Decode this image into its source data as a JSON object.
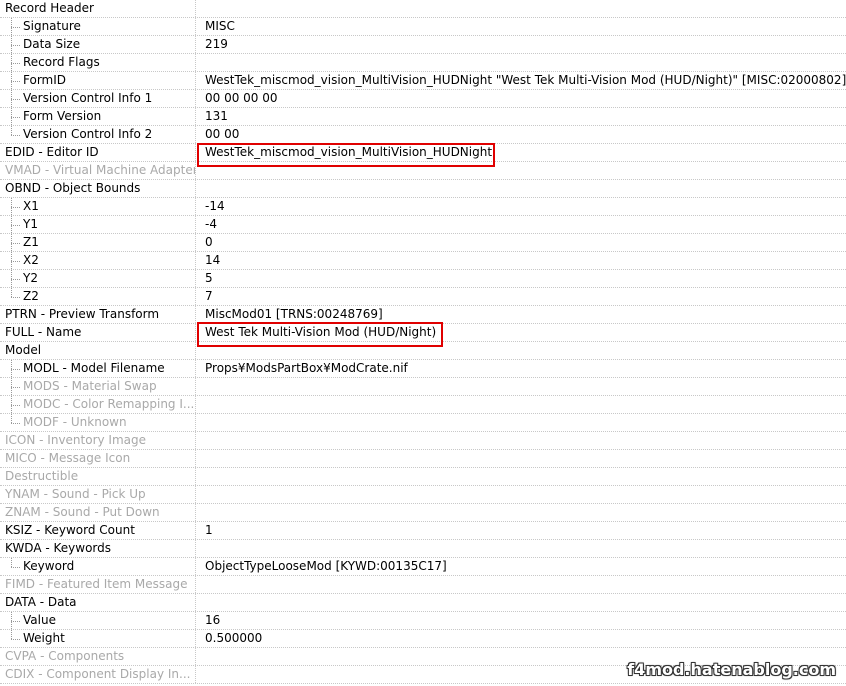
{
  "rows": [
    {
      "name": "Record Header",
      "value": "",
      "level": 0,
      "dim": false
    },
    {
      "name": "Signature",
      "value": "MISC",
      "level": 1,
      "dim": false
    },
    {
      "name": "Data Size",
      "value": "219",
      "level": 1,
      "dim": false
    },
    {
      "name": "Record Flags",
      "value": "",
      "level": 1,
      "dim": false
    },
    {
      "name": "FormID",
      "value": "WestTek_miscmod_vision_MultiVision_HUDNight \"West Tek Multi-Vision Mod (HUD/Night)\" [MISC:02000802]",
      "level": 1,
      "dim": false
    },
    {
      "name": "Version Control Info 1",
      "value": "00 00 00 00",
      "level": 1,
      "dim": false
    },
    {
      "name": "Form Version",
      "value": "131",
      "level": 1,
      "dim": false
    },
    {
      "name": "Version Control Info 2",
      "value": "00 00",
      "level": 1,
      "dim": false,
      "last": true
    },
    {
      "name": "EDID - Editor ID",
      "value": "WestTek_miscmod_vision_MultiVision_HUDNight",
      "level": 0,
      "dim": false,
      "highlight": true
    },
    {
      "name": "VMAD - Virtual Machine Adapter",
      "value": "",
      "level": 0,
      "dim": true
    },
    {
      "name": "OBND - Object Bounds",
      "value": "",
      "level": 0,
      "dim": false
    },
    {
      "name": "X1",
      "value": "-14",
      "level": 1,
      "dim": false
    },
    {
      "name": "Y1",
      "value": "-4",
      "level": 1,
      "dim": false
    },
    {
      "name": "Z1",
      "value": "0",
      "level": 1,
      "dim": false
    },
    {
      "name": "X2",
      "value": "14",
      "level": 1,
      "dim": false
    },
    {
      "name": "Y2",
      "value": "5",
      "level": 1,
      "dim": false
    },
    {
      "name": "Z2",
      "value": "7",
      "level": 1,
      "dim": false,
      "last": true
    },
    {
      "name": "PTRN - Preview Transform",
      "value": "MiscMod01 [TRNS:00248769]",
      "level": 0,
      "dim": false
    },
    {
      "name": "FULL - Name",
      "value": "West Tek Multi-Vision Mod (HUD/Night)",
      "level": 0,
      "dim": false,
      "highlight": true
    },
    {
      "name": "Model",
      "value": "",
      "level": 0,
      "dim": false
    },
    {
      "name": "MODL - Model Filename",
      "value": "Props¥ModsPartBox¥ModCrate.nif",
      "level": 1,
      "dim": false
    },
    {
      "name": "MODS - Material Swap",
      "value": "",
      "level": 1,
      "dim": true
    },
    {
      "name": "MODC - Color Remapping I...",
      "value": "",
      "level": 1,
      "dim": true
    },
    {
      "name": "MODF - Unknown",
      "value": "",
      "level": 1,
      "dim": true,
      "last": true
    },
    {
      "name": "ICON - Inventory Image",
      "value": "",
      "level": 0,
      "dim": true
    },
    {
      "name": "MICO - Message Icon",
      "value": "",
      "level": 0,
      "dim": true
    },
    {
      "name": "Destructible",
      "value": "",
      "level": 0,
      "dim": true
    },
    {
      "name": "YNAM - Sound - Pick Up",
      "value": "",
      "level": 0,
      "dim": true
    },
    {
      "name": "ZNAM - Sound - Put Down",
      "value": "",
      "level": 0,
      "dim": true
    },
    {
      "name": "KSIZ - Keyword Count",
      "value": "1",
      "level": 0,
      "dim": false
    },
    {
      "name": "KWDA - Keywords",
      "value": "",
      "level": 0,
      "dim": false
    },
    {
      "name": "Keyword",
      "value": "ObjectTypeLooseMod [KYWD:00135C17]",
      "level": 1,
      "dim": false,
      "last": true
    },
    {
      "name": "FIMD - Featured Item Message",
      "value": "",
      "level": 0,
      "dim": true
    },
    {
      "name": "DATA - Data",
      "value": "",
      "level": 0,
      "dim": false
    },
    {
      "name": "Value",
      "value": "16",
      "level": 1,
      "dim": false
    },
    {
      "name": "Weight",
      "value": "0.500000",
      "level": 1,
      "dim": false,
      "last": true
    },
    {
      "name": "CVPA - Components",
      "value": "",
      "level": 0,
      "dim": true
    },
    {
      "name": "CDIX - Component Display In...",
      "value": "",
      "level": 0,
      "dim": true
    }
  ],
  "watermark": "f4mod.hatenablog.com"
}
